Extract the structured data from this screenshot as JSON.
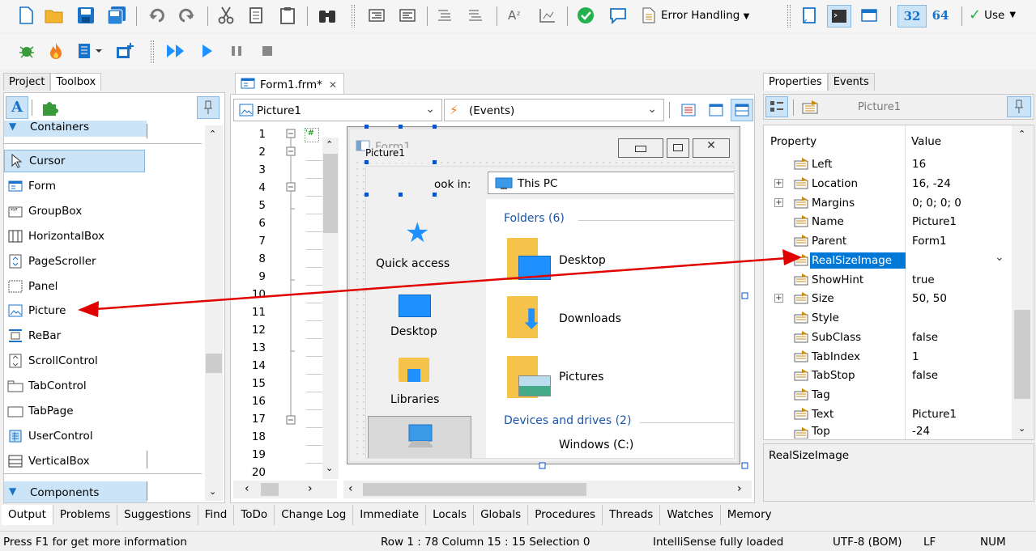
{
  "toolbar": {
    "error_handling_label": "Error Handling",
    "bit32": "32",
    "bit64": "64",
    "use_label": "Use"
  },
  "left_panel": {
    "tabs": [
      "Project",
      "Toolbox"
    ],
    "groups": {
      "containers": "Containers",
      "components": "Components"
    },
    "items": [
      "Cursor",
      "Form",
      "GroupBox",
      "HorizontalBox",
      "PageScroller",
      "Panel",
      "Picture",
      "ReBar",
      "ScrollControl",
      "TabControl",
      "TabPage",
      "UserControl",
      "VerticalBox"
    ]
  },
  "editor": {
    "tab_title": "Form1.frm*",
    "object_combo": "Picture1",
    "events_combo": "(Events)",
    "line_numbers": [
      "1",
      "2",
      "3",
      "4",
      "5",
      "6",
      "7",
      "8",
      "9",
      "10",
      "11",
      "12",
      "13",
      "14",
      "15",
      "16",
      "17",
      "18",
      "19",
      "20"
    ]
  },
  "designer": {
    "form_title": "Form1",
    "picture_label": "Picture1",
    "look_in": "ook in:",
    "look_in_value": "This PC",
    "quick_access": "Quick access",
    "desktop": "Desktop",
    "libraries": "Libraries",
    "this_pc": "This PC",
    "folders_header": "Folders (6)",
    "folders": [
      "Desktop",
      "Downloads",
      "Pictures"
    ],
    "devices_header": "Devices and drives (2)",
    "drive": "Windows (C:)"
  },
  "right_panel": {
    "tabs": [
      "Properties",
      "Events"
    ],
    "object_name": "Picture1",
    "col_property": "Property",
    "col_value": "Value",
    "properties": [
      {
        "name": "Left",
        "value": "16"
      },
      {
        "name": "Location",
        "value": "16, -24"
      },
      {
        "name": "Margins",
        "value": "0; 0; 0; 0"
      },
      {
        "name": "Name",
        "value": "Picture1"
      },
      {
        "name": "Parent",
        "value": "Form1"
      },
      {
        "name": "RealSizeImage",
        "value": ""
      },
      {
        "name": "ShowHint",
        "value": "true"
      },
      {
        "name": "Size",
        "value": "50, 50"
      },
      {
        "name": "Style",
        "value": ""
      },
      {
        "name": "SubClass",
        "value": "false"
      },
      {
        "name": "TabIndex",
        "value": "1"
      },
      {
        "name": "TabStop",
        "value": "false"
      },
      {
        "name": "Tag",
        "value": ""
      },
      {
        "name": "Text",
        "value": "Picture1"
      },
      {
        "name": "Top",
        "value": "-24"
      }
    ],
    "description": "RealSizeImage"
  },
  "bottom_tabs": [
    "Output",
    "Problems",
    "Suggestions",
    "Find",
    "ToDo",
    "Change Log",
    "Immediate",
    "Locals",
    "Globals",
    "Procedures",
    "Threads",
    "Watches",
    "Memory"
  ],
  "status": {
    "help": "Press F1 for get more information",
    "position": "Row 1 : 78  Column 15 : 15  Selection 0",
    "intellisense": "IntelliSense fully loaded",
    "encoding": "UTF-8 (BOM)",
    "eol": "LF",
    "num": "NUM"
  },
  "colors": {
    "accent": "#1e90ff",
    "selection": "#0078d7",
    "arrow": "#e00000",
    "toolbox_highlight": "#cce4f7"
  }
}
